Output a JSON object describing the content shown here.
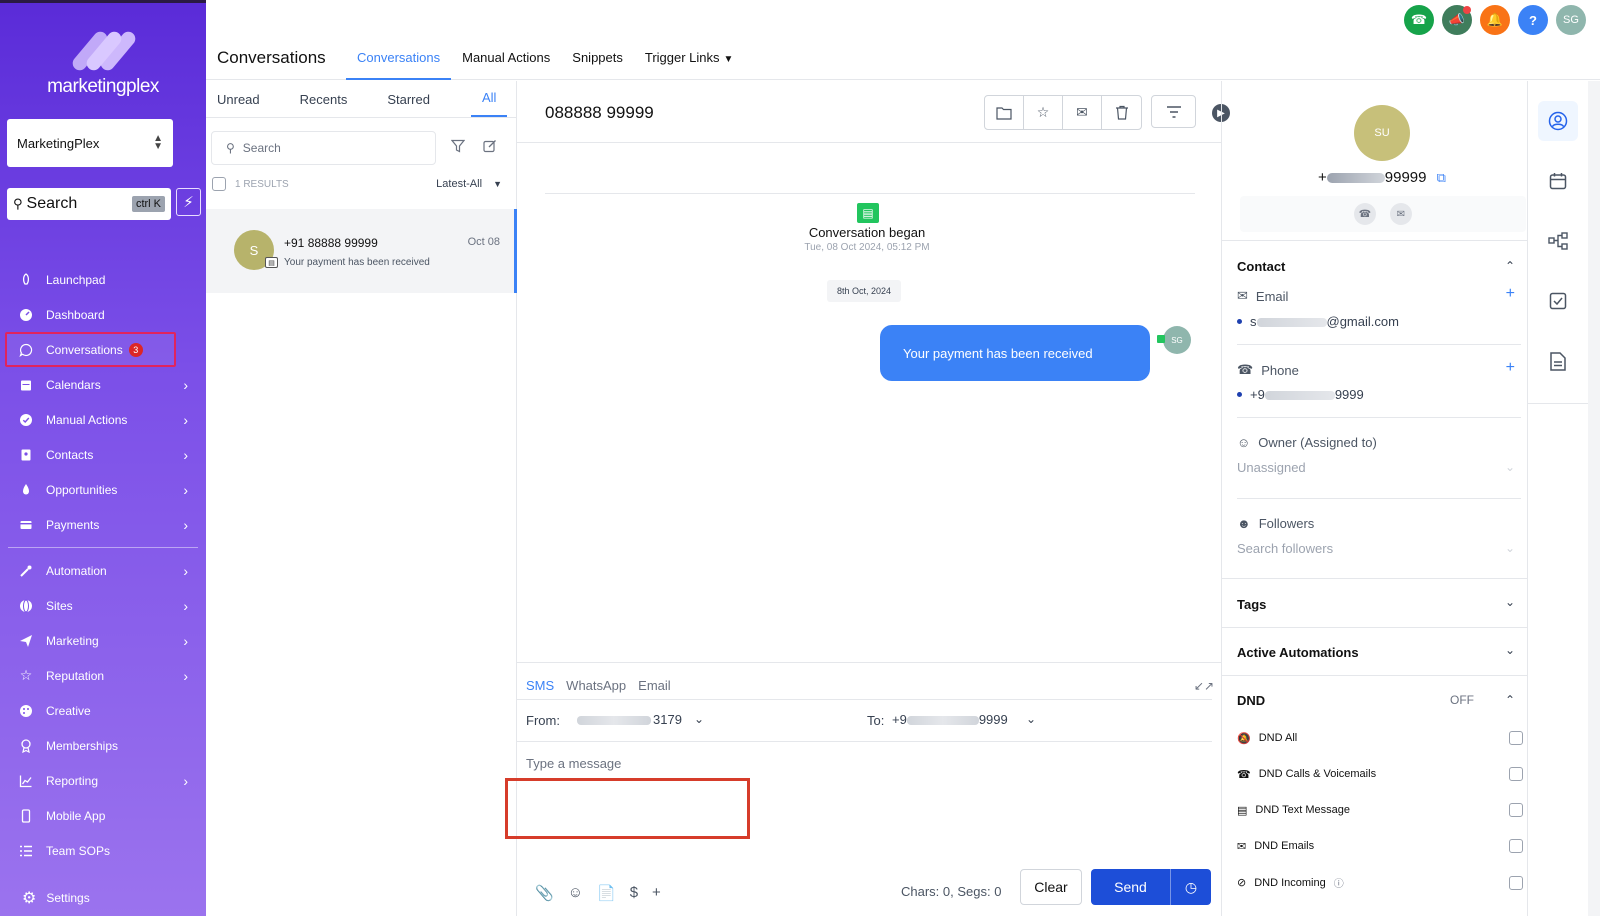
{
  "brand": {
    "logo_text": "marketingplex"
  },
  "sidebar": {
    "account_name": "MarketingPlex",
    "search_label": "Search",
    "search_shortcut": "ctrl K",
    "items": [
      {
        "label": "Launchpad",
        "icon": "rocket-icon",
        "has_chevron": false
      },
      {
        "label": "Dashboard",
        "icon": "dashboard-icon",
        "has_chevron": false
      },
      {
        "label": "Conversations",
        "icon": "chat-icon",
        "badge": "3",
        "active": true
      },
      {
        "label": "Calendars",
        "icon": "calendar-icon",
        "has_chevron": true
      },
      {
        "label": "Manual Actions",
        "icon": "check-circle-icon",
        "has_chevron": true
      },
      {
        "label": "Contacts",
        "icon": "contacts-icon",
        "has_chevron": true
      },
      {
        "label": "Opportunities",
        "icon": "funnel-icon",
        "has_chevron": true
      },
      {
        "label": "Payments",
        "icon": "payments-icon",
        "has_chevron": true
      },
      {
        "label": "Automation",
        "icon": "automation-icon",
        "has_chevron": true
      },
      {
        "label": "Sites",
        "icon": "globe-icon",
        "has_chevron": true
      },
      {
        "label": "Marketing",
        "icon": "send-icon",
        "has_chevron": true
      },
      {
        "label": "Reputation",
        "icon": "star-icon",
        "has_chevron": true
      },
      {
        "label": "Creative",
        "icon": "palette-icon",
        "has_chevron": false
      },
      {
        "label": "Memberships",
        "icon": "award-icon",
        "has_chevron": false
      },
      {
        "label": "Reporting",
        "icon": "chart-icon",
        "has_chevron": true
      },
      {
        "label": "Mobile App",
        "icon": "mobile-icon",
        "has_chevron": false
      },
      {
        "label": "Team SOPs",
        "icon": "list-icon",
        "has_chevron": false
      }
    ],
    "settings_label": "Settings"
  },
  "header": {
    "title": "Conversations",
    "tabs": [
      "Conversations",
      "Manual Actions",
      "Snippets",
      "Trigger Links"
    ],
    "user_initials": "SG",
    "colors": {
      "phone": "#16a34a",
      "megaphone": "#3f7d5c",
      "bell": "#f97316",
      "help": "#3b82f6",
      "user": "#8fb6ad"
    }
  },
  "list": {
    "tabs": [
      "Unread",
      "Recents",
      "Starred",
      "All"
    ],
    "search_placeholder": "Search",
    "results": "1 RESULTS",
    "sort": "Latest-All",
    "conversation": {
      "initial": "S",
      "name": "+91 88888 99999",
      "date": "Oct 08",
      "preview": "Your payment has been received"
    }
  },
  "chat": {
    "title": "088888 99999",
    "began_label": "Conversation began",
    "began_time": "Tue, 08 Oct 2024, 05:12 PM",
    "date_chip": "8th Oct, 2024",
    "message": "Your payment has been received",
    "sender_initials": "SG",
    "channels": [
      "SMS",
      "WhatsApp",
      "Email"
    ],
    "from_label": "From:",
    "from_suffix": "3179",
    "to_label": "To:",
    "to_prefix": "+9",
    "to_suffix": "9999",
    "message_placeholder": "Type a message",
    "counter": "Chars: 0, Segs: 0",
    "clear_label": "Clear",
    "send_label": "Send"
  },
  "contact": {
    "initials": "SU",
    "phone_prefix": "+",
    "phone_suffix": "99999",
    "section_contact": "Contact",
    "email_label": "Email",
    "email_prefix": "s",
    "email_domain": "@gmail.com",
    "phone_label": "Phone",
    "phone_value_prefix": "+9",
    "phone_value_suffix": "9999",
    "owner_label": "Owner (Assigned to)",
    "owner_value": "Unassigned",
    "followers_label": "Followers",
    "followers_placeholder": "Search followers",
    "tags_label": "Tags",
    "automations_label": "Active Automations",
    "dnd_label": "DND",
    "dnd_state": "OFF",
    "dnd_items": [
      "DND All",
      "DND Calls & Voicemails",
      "DND Text Message",
      "DND Emails",
      "DND Incoming"
    ]
  }
}
